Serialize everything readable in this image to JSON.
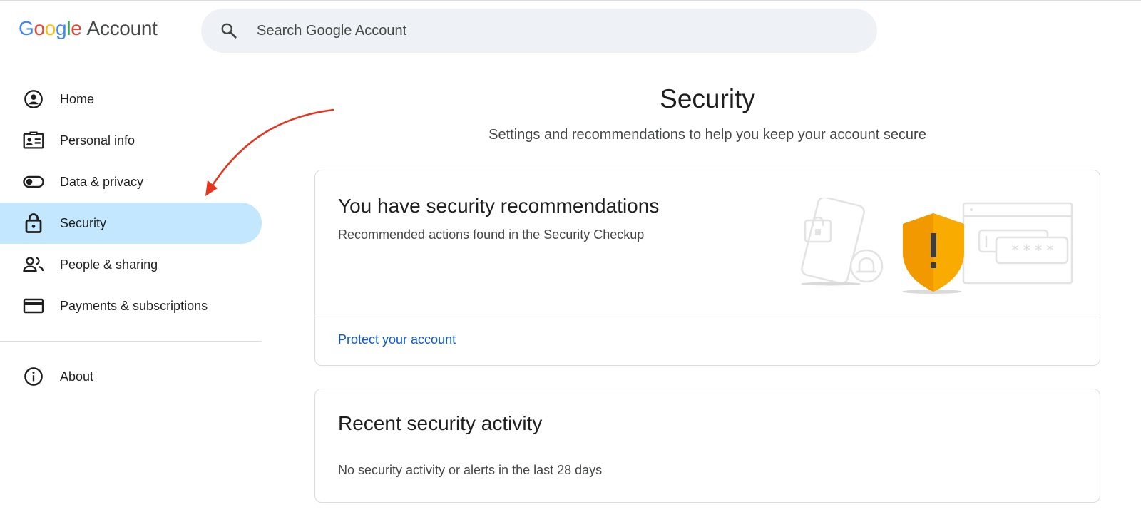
{
  "header": {
    "logo_letters": [
      "G",
      "o",
      "o",
      "g",
      "l",
      "e"
    ],
    "logo_suffix": "Account",
    "search_placeholder": "Search Google Account"
  },
  "sidebar": {
    "items": [
      {
        "label": "Home",
        "icon": "account-circle-icon"
      },
      {
        "label": "Personal info",
        "icon": "id-card-icon"
      },
      {
        "label": "Data & privacy",
        "icon": "toggle-icon"
      },
      {
        "label": "Security",
        "icon": "lock-icon",
        "active": true
      },
      {
        "label": "People & sharing",
        "icon": "people-icon"
      },
      {
        "label": "Payments & subscriptions",
        "icon": "credit-card-icon"
      }
    ],
    "footer_items": [
      {
        "label": "About",
        "icon": "info-icon"
      }
    ]
  },
  "main": {
    "title": "Security",
    "subtitle": "Settings and recommendations to help you keep your account secure",
    "recommendations_card": {
      "title": "You have security recommendations",
      "description": "Recommended actions found in the Security Checkup",
      "link": "Protect your account",
      "illustration_password_mask": "* * * *"
    },
    "activity_card": {
      "title": "Recent security activity",
      "description": "No security activity or alerts in the last 28 days"
    }
  },
  "colors": {
    "accent_active": "#c2e7ff",
    "link": "#0b57d0",
    "shield": "#f9ab00",
    "annotation_arrow": "#e8341c"
  }
}
